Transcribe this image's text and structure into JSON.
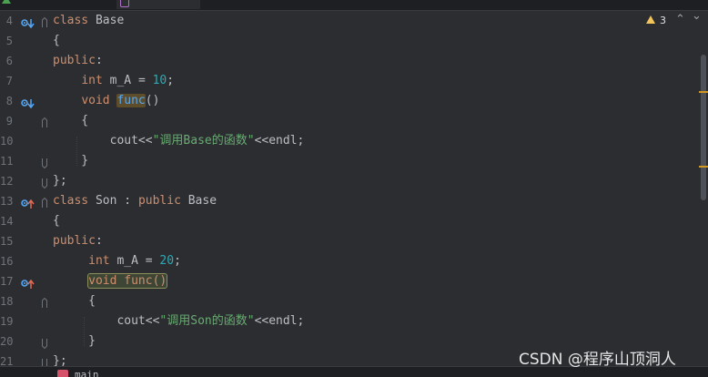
{
  "tabs": [
    {
      "label": ""
    },
    {
      "label": ""
    }
  ],
  "lines": [
    {
      "n": "4",
      "tokens": [
        {
          "t": "class ",
          "c": "kw"
        },
        {
          "t": "Base",
          "c": ""
        }
      ],
      "icon": "override",
      "fold": "open"
    },
    {
      "n": "5",
      "tokens": [
        {
          "t": "{",
          "c": ""
        }
      ]
    },
    {
      "n": "6",
      "tokens": [
        {
          "t": "public",
          "c": "kw"
        },
        {
          "t": ":",
          "c": ""
        }
      ]
    },
    {
      "n": "7",
      "tokens": [
        {
          "t": "    ",
          "c": ""
        },
        {
          "t": "int ",
          "c": "kw"
        },
        {
          "t": "m_A ",
          "c": ""
        },
        {
          "t": "= ",
          "c": ""
        },
        {
          "t": "10",
          "c": "num"
        },
        {
          "t": ";",
          "c": ""
        }
      ]
    },
    {
      "n": "8",
      "tokens": [
        {
          "t": "    ",
          "c": ""
        },
        {
          "t": "void ",
          "c": "kw"
        },
        {
          "t": "func",
          "c": "fn hl"
        },
        {
          "t": "()",
          "c": ""
        }
      ],
      "icon": "override"
    },
    {
      "n": "9",
      "tokens": [
        {
          "t": "    {",
          "c": ""
        }
      ],
      "fold": "open"
    },
    {
      "n": "10",
      "tokens": [
        {
          "t": "        ",
          "c": ""
        },
        {
          "t": "cout<<",
          "c": ""
        },
        {
          "t": "\"调用Base的函数\"",
          "c": "str"
        },
        {
          "t": "<<endl;",
          "c": ""
        }
      ]
    },
    {
      "n": "11",
      "tokens": [
        {
          "t": "    }",
          "c": ""
        }
      ],
      "fold": "close"
    },
    {
      "n": "12",
      "tokens": [
        {
          "t": "};",
          "c": ""
        }
      ],
      "fold": "close"
    },
    {
      "n": "13",
      "tokens": [
        {
          "t": "class ",
          "c": "kw"
        },
        {
          "t": "Son ",
          "c": ""
        },
        {
          "t": ": ",
          "c": ""
        },
        {
          "t": "public ",
          "c": "kw"
        },
        {
          "t": "Base",
          "c": ""
        }
      ],
      "icon": "implement",
      "fold": "open"
    },
    {
      "n": "14",
      "tokens": [
        {
          "t": "{",
          "c": ""
        }
      ]
    },
    {
      "n": "15",
      "tokens": [
        {
          "t": "public",
          "c": "kw"
        },
        {
          "t": ":",
          "c": ""
        }
      ]
    },
    {
      "n": "16",
      "tokens": [
        {
          "t": "     ",
          "c": ""
        },
        {
          "t": "int ",
          "c": "kw"
        },
        {
          "t": "m_A ",
          "c": ""
        },
        {
          "t": "= ",
          "c": ""
        },
        {
          "t": "20",
          "c": "num"
        },
        {
          "t": ";",
          "c": ""
        }
      ]
    },
    {
      "n": "17",
      "tokens": [
        {
          "t": "     ",
          "c": ""
        },
        {
          "t": "void func()",
          "c": "kw hl2"
        }
      ],
      "icon": "implement"
    },
    {
      "n": "18",
      "tokens": [
        {
          "t": "     {",
          "c": ""
        }
      ],
      "fold": "open"
    },
    {
      "n": "19",
      "tokens": [
        {
          "t": "         ",
          "c": ""
        },
        {
          "t": "cout<<",
          "c": ""
        },
        {
          "t": "\"调用Son的函数\"",
          "c": "str"
        },
        {
          "t": "<<endl;",
          "c": ""
        }
      ]
    },
    {
      "n": "20",
      "tokens": [
        {
          "t": "     }",
          "c": ""
        }
      ],
      "fold": "close"
    },
    {
      "n": "21",
      "tokens": [
        {
          "t": "};",
          "c": ""
        }
      ],
      "fold": "close"
    }
  ],
  "inspections": {
    "warning_count": "3"
  },
  "bottom": {
    "label": "main"
  },
  "watermark": "CSDN @程序山顶洞人",
  "colors": {
    "keyword": "#cf8e6d",
    "number": "#2aacb8",
    "string": "#6aab73",
    "function": "#56a8f5",
    "text": "#bcbec4",
    "background": "#2b2d30"
  }
}
